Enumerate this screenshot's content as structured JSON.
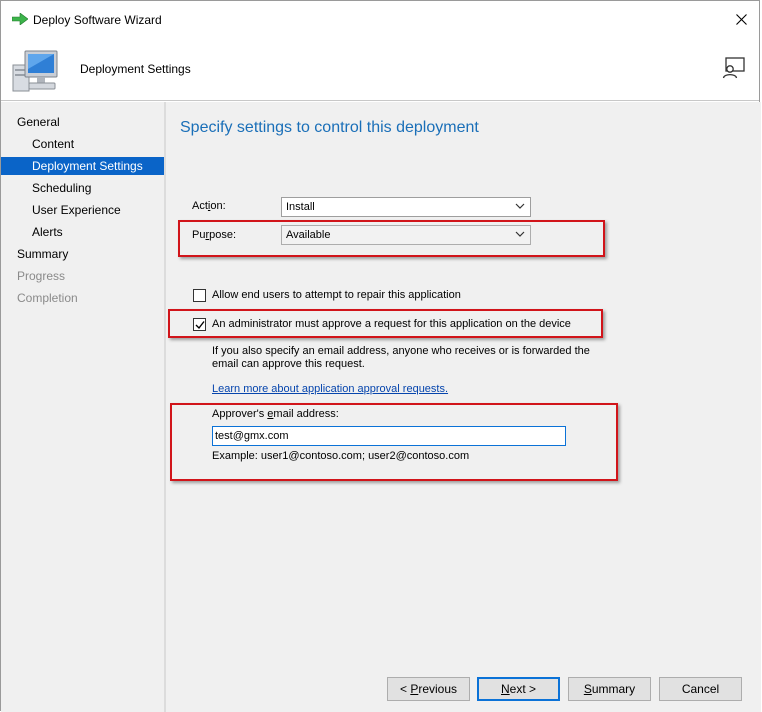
{
  "window": {
    "title": "Deploy Software Wizard"
  },
  "header": {
    "title": "Deployment Settings"
  },
  "nav": {
    "items": [
      {
        "label": "General",
        "state": "normal"
      },
      {
        "label": "Content",
        "state": "normal"
      },
      {
        "label": "Deployment Settings",
        "state": "selected"
      },
      {
        "label": "Scheduling",
        "state": "normal"
      },
      {
        "label": "User Experience",
        "state": "normal"
      },
      {
        "label": "Alerts",
        "state": "normal"
      },
      {
        "label": "Summary",
        "state": "normal"
      },
      {
        "label": "Progress",
        "state": "disabled"
      },
      {
        "label": "Completion",
        "state": "disabled"
      }
    ]
  },
  "main": {
    "title": "Specify settings to control this deployment",
    "action": {
      "label_pre": "Act",
      "label_ul": "i",
      "label_post": "on:",
      "value": "Install"
    },
    "purpose": {
      "label_pre": "Pu",
      "label_ul": "r",
      "label_post": "pose:",
      "value": "Available"
    },
    "repair_checkbox": {
      "label": "Allow end users to attempt to repair this application",
      "checked": false
    },
    "approval_checkbox": {
      "label": "An administrator must approve a request for this application on the device",
      "checked": true
    },
    "approval_note_line1": "If you also specify an email address, anyone who receives or is forwarded the",
    "approval_note_line2": "email can approve this request.",
    "learn_more_link": "Learn more about application approval requests.",
    "approver": {
      "label_pre": "Approver's ",
      "label_ul": "e",
      "label_post": "mail address:",
      "value": "test@gmx.com",
      "example": "Example: user1@contoso.com; user2@contoso.com"
    }
  },
  "buttons": {
    "previous": {
      "pre": "< ",
      "ul": "P",
      "post": "revious"
    },
    "next": {
      "pre": "",
      "ul": "N",
      "post": "ext >"
    },
    "summary": {
      "pre": "",
      "ul": "S",
      "post": "ummary"
    },
    "cancel": "Cancel"
  },
  "colors": {
    "accent": "#0a64c8",
    "title_blue": "#1a6fb8",
    "link": "#0645ad",
    "highlight_red": "#d1141a",
    "nav_bg": "#f0f0f0"
  }
}
